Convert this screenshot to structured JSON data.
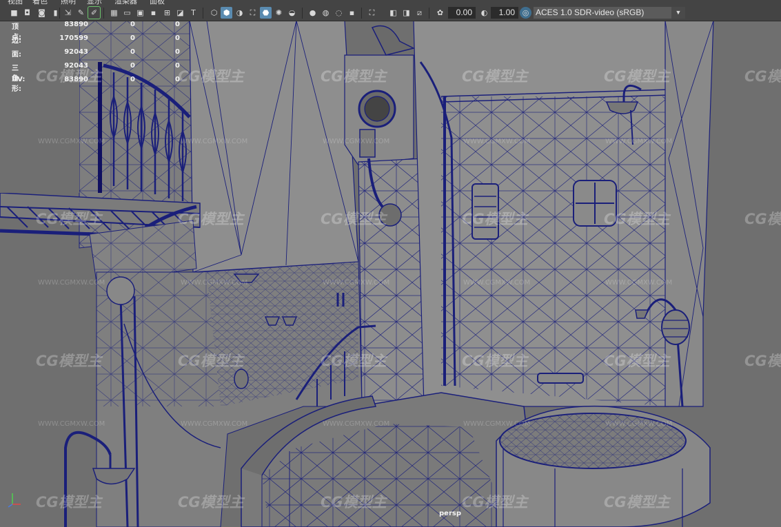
{
  "menu": [
    "视图",
    "着色",
    "照明",
    "显示",
    "渲染器",
    "面板"
  ],
  "toolbar": {
    "icons": [
      "camera-select-icon",
      "camera-attributes-icon",
      "bookmark-icon",
      "image-plane-icon",
      "2d-pan-zoom-icon",
      "grease-pencil-icon",
      "grid-icon",
      "film-gate-icon",
      "resolution-gate-icon",
      "gate-mask-icon",
      "field-chart-icon",
      "safe-action-icon",
      "safe-title-icon",
      "wireframe-icon",
      "smooth-shade-icon",
      "default-material-icon",
      "wireframe-on-shaded-icon",
      "textured-icon",
      "all-lights-icon",
      "shadows-icon",
      "screen-space-ao-icon",
      "motion-blur-icon",
      "anti-aliasing-icon",
      "depth-of-field-icon",
      "isolate-select-icon",
      "xray-icon",
      "xray-joints-icon",
      "xray-components-icon",
      "exposure-icon",
      "gamma-icon",
      "color-management-icon"
    ],
    "exposure": "0.00",
    "gamma": "1.00",
    "color_space": "ACES 1.0 SDR-video (sRGB)"
  },
  "hud": [
    {
      "label": "顶点:",
      "v1": "83890",
      "v2": "0",
      "v3": "0"
    },
    {
      "label": "边:",
      "v1": "170599",
      "v2": "0",
      "v3": "0"
    },
    {
      "label": "面:",
      "v1": "92043",
      "v2": "0",
      "v3": "0"
    },
    {
      "label": "三角形:",
      "v1": "92043",
      "v2": "0",
      "v3": "0"
    },
    {
      "label": "UV:",
      "v1": "83890",
      "v2": "0",
      "v3": "0"
    }
  ],
  "camera": "persp",
  "watermark": {
    "logo": "CG模型主",
    "url": "WWW.CGMXW.COM"
  },
  "colors": {
    "wire": "#1a1f7a",
    "surface": "#8d8d8d",
    "background": "#6f6f6f",
    "toolbar": "#444444",
    "active": "#5a8bb0"
  }
}
